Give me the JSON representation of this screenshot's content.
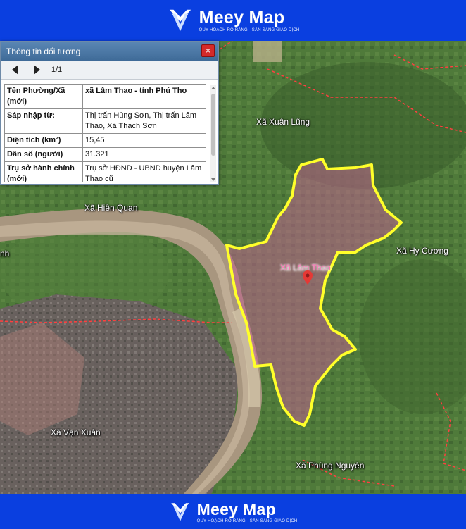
{
  "brand": {
    "name": "Meey Map",
    "tagline": "QUY HOẠCH RÕ RÀNG - SẴN SÀNG GIAO DỊCH"
  },
  "info_panel": {
    "title": "Thông tin đối tượng",
    "close_icon": "×",
    "pager": "1/1",
    "rows": [
      {
        "label": "Tên Phường/Xã (mới)",
        "value": "xã Lâm Thao - tỉnh Phú Thọ"
      },
      {
        "label": "Sáp nhập từ:",
        "value": "Thị trấn Hùng Sơn, Thị trấn Lâm Thao, Xã Thạch Sơn"
      },
      {
        "label": "Diện tích (km²)",
        "value": "15,45"
      },
      {
        "label": "Dân số (người)",
        "value": "31.321"
      },
      {
        "label": "Trụ sở hành chính (mới)",
        "value": "Trụ sở HĐND - UBND huyện Lâm Thao cũ"
      }
    ]
  },
  "map": {
    "highlight_color": "#ffff2a",
    "highlight_fill": "#c0608f",
    "boundary_color": "#ff4040",
    "labels": {
      "xuan_lung": "Xã Xuân Lũng",
      "hien_quan": "Xã Hiền Quan",
      "lam_thao": "Xã Lâm Thao",
      "hy_cuong": "Xã Hy Cương",
      "van_xuan": "Xã Vạn Xuân",
      "phung_nguyen": "Xã Phùng Nguyên",
      "edge_left": "nh"
    },
    "icons": [
      "map-pin-icon"
    ]
  }
}
